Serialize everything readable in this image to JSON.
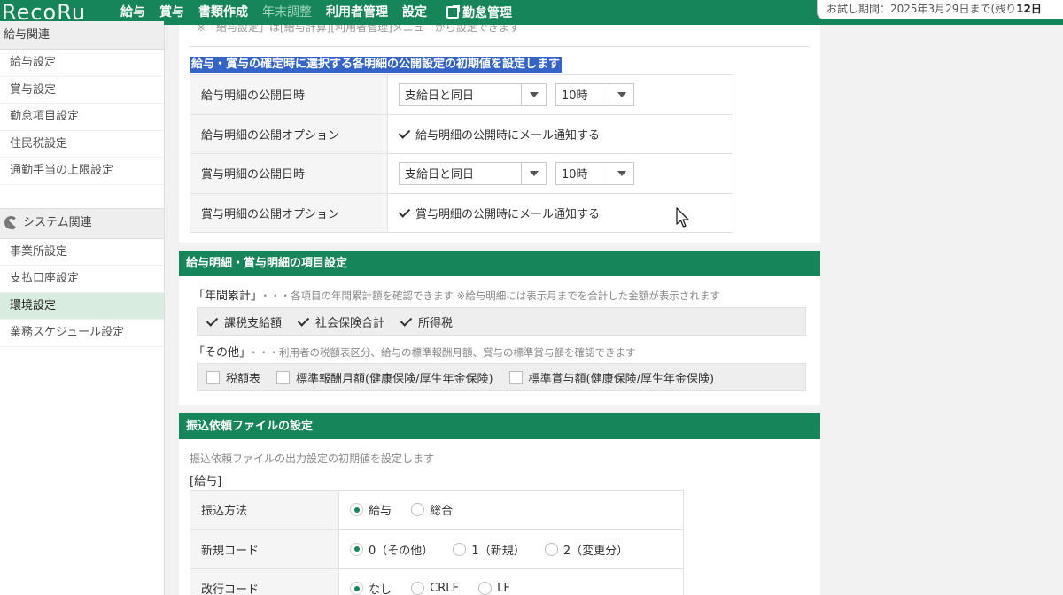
{
  "topnav": {
    "logo": "RecoRu",
    "items": [
      {
        "label": "給与",
        "disabled": false
      },
      {
        "label": "賞与",
        "disabled": false
      },
      {
        "label": "書類作成",
        "disabled": false
      },
      {
        "label": "年末調整",
        "disabled": true
      },
      {
        "label": "利用者管理",
        "disabled": false
      },
      {
        "label": "設定",
        "disabled": false
      }
    ],
    "external_link": {
      "label": "勤怠管理",
      "icon": "external-link-icon"
    },
    "trial": {
      "prefix": "お試し期間：2025年3月29日まで(残り",
      "days": "12日"
    }
  },
  "sidebar": {
    "salary_head": "給与関連",
    "salary_items": [
      "給与設定",
      "賞与設定",
      "勤怠項目設定",
      "住民税設定",
      "通勤手当の上限設定"
    ],
    "system_head": "システム関連",
    "system_icon": "wrench-icon",
    "system_items": [
      "事業所設定",
      "支払口座設定",
      "環境設定",
      "業務スケジュール設定"
    ],
    "active_item": "環境設定"
  },
  "publish": {
    "note": "※「給与設定」は[給与計算][利用者管理]メニューから設定できます",
    "heading": "給与・賞与の確定時に選択する各明細の公開設定の初期値を設定します",
    "rows": [
      {
        "label": "給与明細の公開日時",
        "day": "支給日と同日",
        "hour": "10時"
      },
      {
        "label": "給与明細の公開オプション",
        "option": "給与明細の公開時にメール通知する"
      },
      {
        "label": "賞与明細の公開日時",
        "day": "支給日と同日",
        "hour": "10時"
      },
      {
        "label": "賞与明細の公開オプション",
        "option": "賞与明細の公開時にメール通知する"
      }
    ]
  },
  "items_setting": {
    "title": "給与明細・賞与明細の項目設定",
    "annual": {
      "label": "「年間累計」",
      "desc": "・・・各項目の年間累計額を確認できます ※給与明細には表示月までを合計した金額が表示されます",
      "checks": [
        {
          "label": "課税支給額",
          "checked": true
        },
        {
          "label": "社会保険合計",
          "checked": true
        },
        {
          "label": "所得税",
          "checked": true
        }
      ]
    },
    "other": {
      "label": "「その他」",
      "desc": "・・・利用者の税額表区分、給与の標準報酬月額、賞与の標準賞与額を確認できます",
      "checks": [
        {
          "label": "税額表",
          "checked": false
        },
        {
          "label": "標準報酬月額(健康保険/厚生年金保険)",
          "checked": false
        },
        {
          "label": "標準賞与額(健康保険/厚生年金保険)",
          "checked": false
        }
      ]
    }
  },
  "transfer": {
    "title": "振込依頼ファイルの設定",
    "desc": "振込依頼ファイルの出力設定の初期値を設定します",
    "bracket": "[給与]",
    "rows": [
      {
        "label": "振込方法",
        "options": [
          {
            "label": "給与",
            "selected": true
          },
          {
            "label": "総合",
            "selected": false
          }
        ]
      },
      {
        "label": "新規コード",
        "options": [
          {
            "label": "0（その他）",
            "selected": true
          },
          {
            "label": "1（新規）",
            "selected": false
          },
          {
            "label": "2（変更分）",
            "selected": false
          }
        ]
      },
      {
        "label": "改行コード",
        "options": [
          {
            "label": "なし",
            "selected": true
          },
          {
            "label": "CRLF",
            "selected": false
          },
          {
            "label": "LF",
            "selected": false
          }
        ]
      }
    ]
  },
  "colors": {
    "brand": "#16855a",
    "highlight": "#3464c8",
    "active": "#d8ecdf"
  }
}
